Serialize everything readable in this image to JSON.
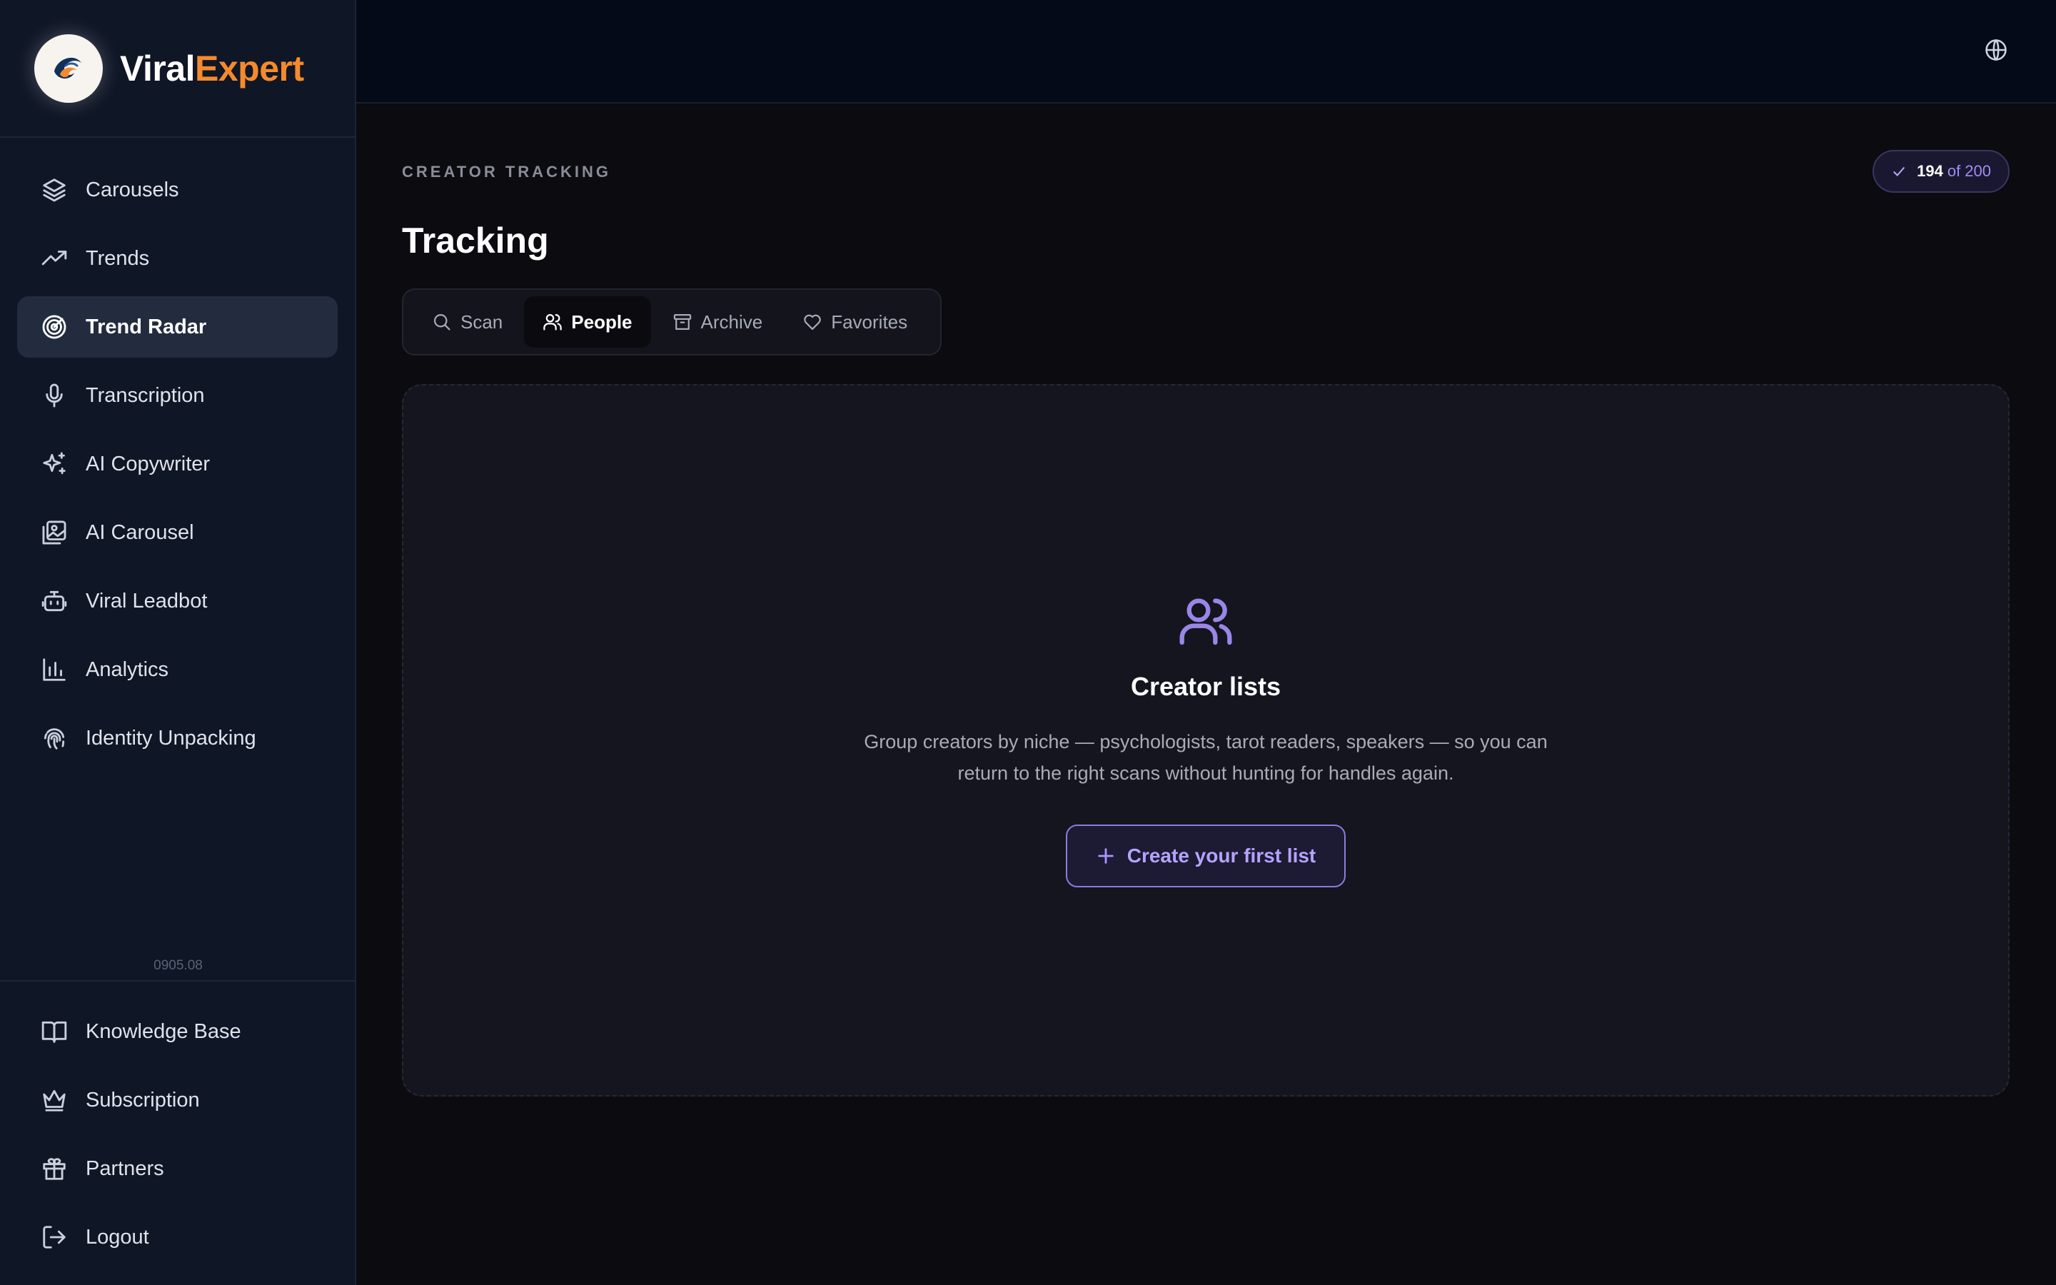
{
  "brand": {
    "name_part1": "Viral",
    "name_part2": "Expert"
  },
  "sidebar": {
    "items": [
      {
        "label": "Carousels",
        "icon": "layers-icon"
      },
      {
        "label": "Trends",
        "icon": "trending-up-icon"
      },
      {
        "label": "Trend Radar",
        "icon": "radar-icon",
        "active": true
      },
      {
        "label": "Transcription",
        "icon": "microphone-icon"
      },
      {
        "label": "AI Copywriter",
        "icon": "sparkles-icon"
      },
      {
        "label": "AI Carousel",
        "icon": "images-icon"
      },
      {
        "label": "Viral Leadbot",
        "icon": "bot-icon"
      },
      {
        "label": "Analytics",
        "icon": "bar-chart-icon"
      },
      {
        "label": "Identity Unpacking",
        "icon": "fingerprint-icon"
      }
    ],
    "version": "0905.08",
    "bottom_items": [
      {
        "label": "Knowledge Base",
        "icon": "book-icon"
      },
      {
        "label": "Subscription",
        "icon": "crown-icon"
      },
      {
        "label": "Partners",
        "icon": "gift-icon"
      },
      {
        "label": "Logout",
        "icon": "logout-icon"
      }
    ]
  },
  "header": {
    "eyebrow": "CREATOR TRACKING",
    "title": "Tracking",
    "quota": {
      "used": "194",
      "total_text": "of 200"
    }
  },
  "tabs": [
    {
      "label": "Scan",
      "icon": "search-icon"
    },
    {
      "label": "People",
      "icon": "users-icon",
      "active": true
    },
    {
      "label": "Archive",
      "icon": "archive-icon"
    },
    {
      "label": "Favorites",
      "icon": "heart-icon"
    }
  ],
  "empty_state": {
    "icon": "users-icon",
    "title": "Creator lists",
    "description": "Group creators by niche — psychologists, tarot readers, speakers — so you can return to the right scans without hunting for handles again.",
    "button_label": "Create your first list"
  },
  "colors": {
    "accent": "#9a86e8",
    "brand_orange": "#f58a2c",
    "sidebar_bg": "#0f1626",
    "main_bg": "#0b0b10"
  }
}
